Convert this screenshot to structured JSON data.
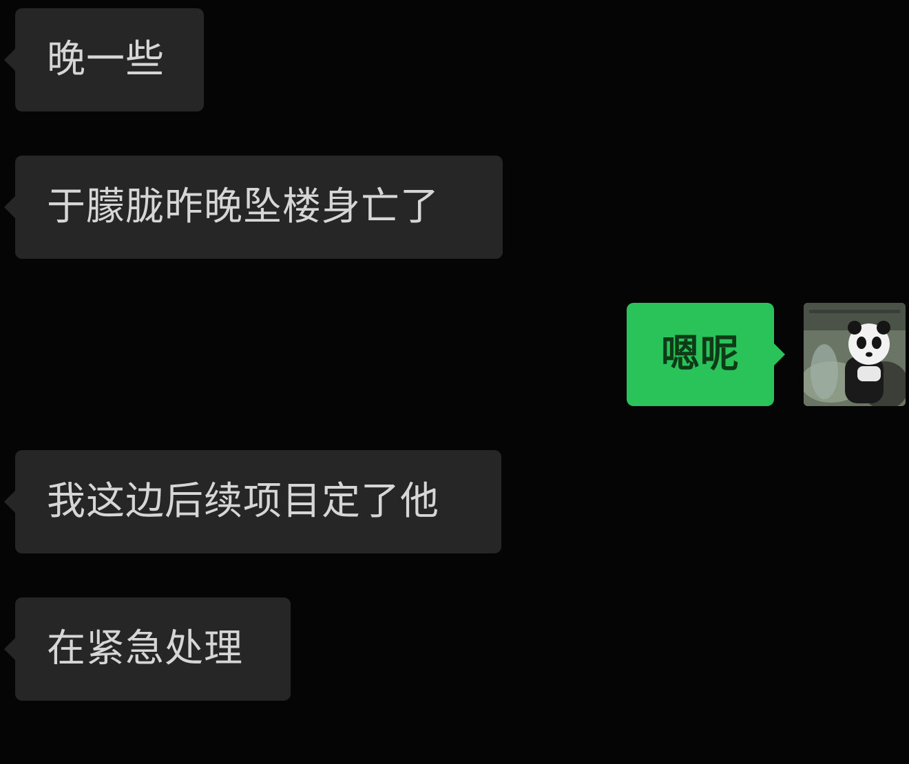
{
  "messages": [
    {
      "side": "left",
      "text": "晚一些"
    },
    {
      "side": "left",
      "text": "于朦胧昨晚坠楼身亡了"
    },
    {
      "side": "right",
      "text": "嗯呢"
    },
    {
      "side": "left",
      "text": "我这边后续项目定了他"
    },
    {
      "side": "left",
      "text": "在紧急处理"
    }
  ],
  "avatar": {
    "icon": "panda-avatar-icon"
  },
  "colors": {
    "background": "#050505",
    "incoming_bubble": "#262626",
    "incoming_text": "#d6d6d6",
    "outgoing_bubble": "#29c35a",
    "outgoing_text": "#0d3b17"
  }
}
